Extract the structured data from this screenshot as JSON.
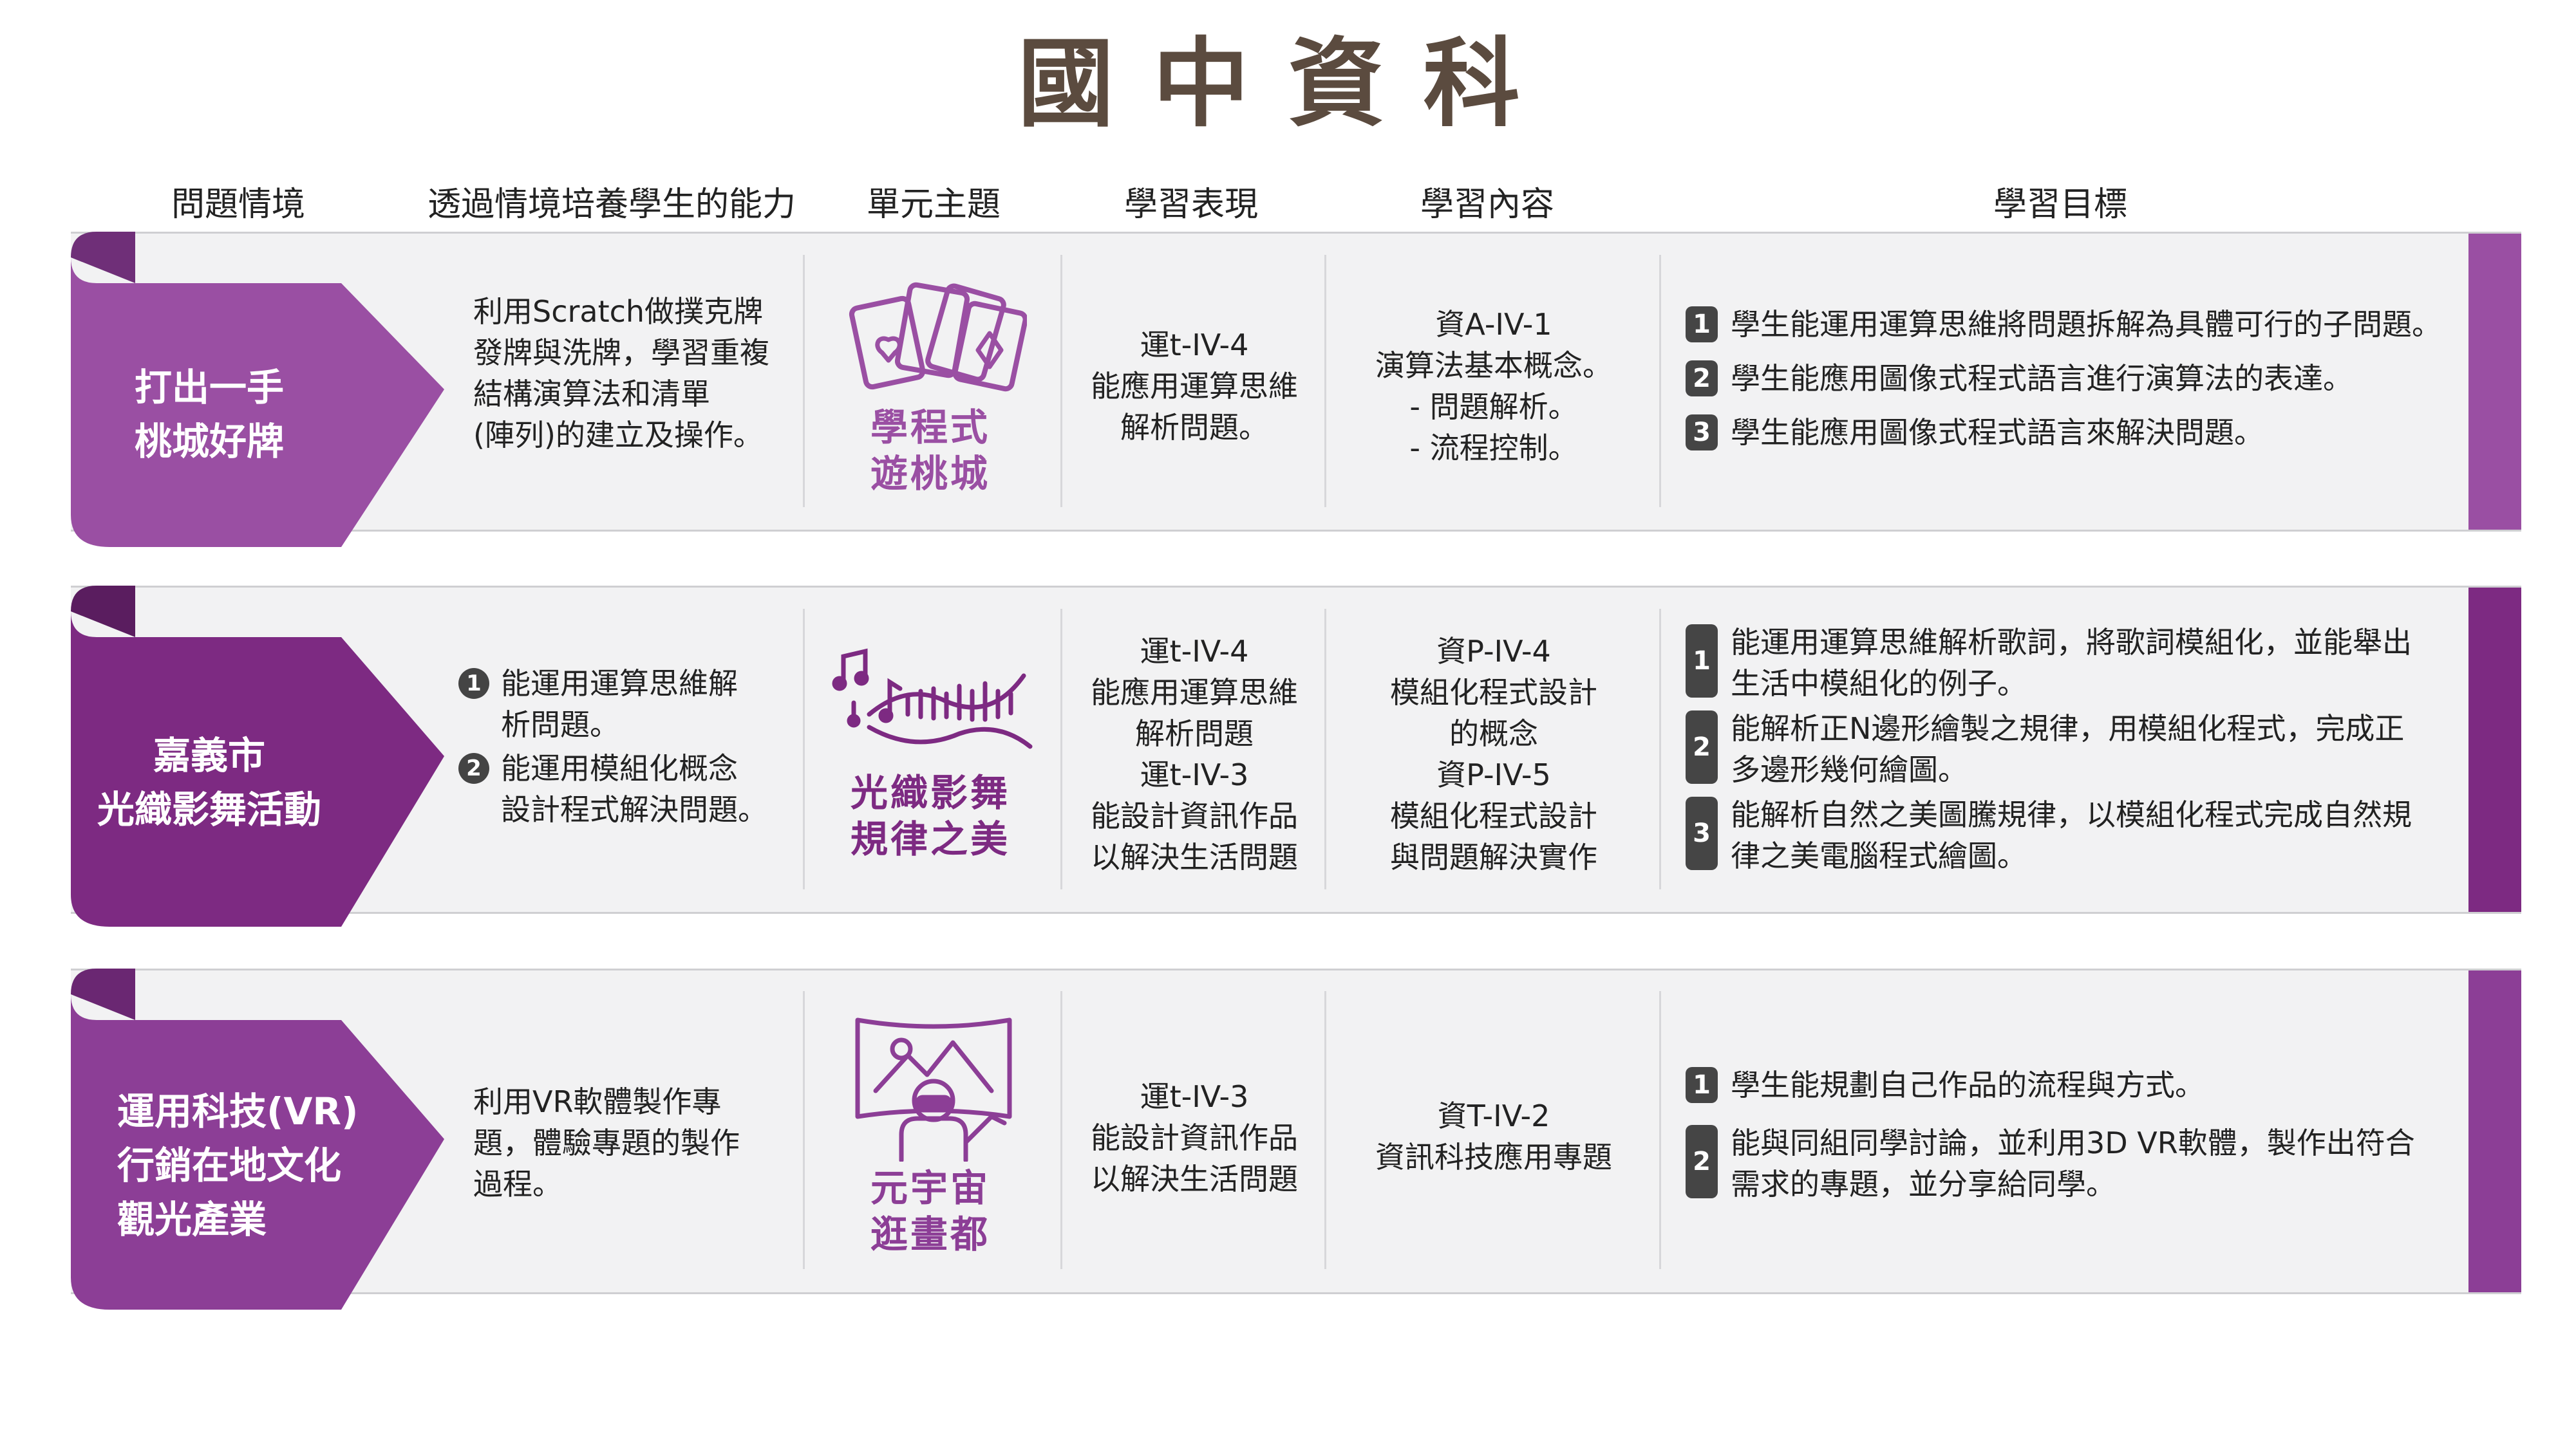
{
  "page_title": "國中資科",
  "columns": [
    "問題情境",
    "透過情境培養學生的能力",
    "單元主題",
    "學習表現",
    "學習內容",
    "學習目標"
  ],
  "colors": {
    "title": "#5b4b3f",
    "row1_accent": "#9a4fa3",
    "row2_accent": "#7d2a82",
    "row3_accent": "#8c3e96",
    "band_bg": "#f2f2f3"
  },
  "rows": [
    {
      "scenario": [
        "打出一手",
        "桃城好牌"
      ],
      "ability_text": [
        "利用Scratch做撲克牌",
        "發牌與洗牌，學習重複",
        "結構演算法和清單",
        "(陣列)的建立及操作。"
      ],
      "theme_icon": "playing-cards-icon",
      "theme": [
        "學程式",
        "遊桃城"
      ],
      "performance": [
        "運t-IV-4",
        "能應用運算思維",
        "解析問題。"
      ],
      "content": [
        "資A-IV-1",
        "演算法基本概念。",
        "- 問題解析。",
        "- 流程控制。"
      ],
      "goals": [
        {
          "num": "1",
          "lines": [
            "學生能運用運算思維將問題拆解為具體可行的子問題。"
          ]
        },
        {
          "num": "2",
          "lines": [
            "學生能應用圖像式程式語言進行演算法的表達。"
          ]
        },
        {
          "num": "3",
          "lines": [
            "學生能應用圖像式程式語言來解決問題。"
          ]
        }
      ]
    },
    {
      "scenario": [
        "嘉義市",
        "光織影舞活動"
      ],
      "ability_items": [
        {
          "num": "1",
          "lines": [
            "能運用運算思維解",
            "析問題。"
          ]
        },
        {
          "num": "2",
          "lines": [
            "能運用模組化概念",
            "設計程式解決問題。"
          ]
        }
      ],
      "theme_icon": "music-notes-icon",
      "theme": [
        "光織影舞",
        "規律之美"
      ],
      "performance": [
        "運t-IV-4",
        "能應用運算思維",
        "解析問題",
        "運t-IV-3",
        "能設計資訊作品",
        "以解決生活問題"
      ],
      "content": [
        "資P-IV-4",
        "模組化程式設計",
        "的概念",
        "資P-IV-5",
        "模組化程式設計",
        "與問題解決實作"
      ],
      "goals": [
        {
          "num": "1",
          "lines": [
            "能運用運算思維解析歌詞，將歌詞模組化，並能舉出",
            "生活中模組化的例子。"
          ]
        },
        {
          "num": "2",
          "lines": [
            "能解析正N邊形繪製之規律，用模組化程式，完成正",
            "多邊形幾何繪圖。"
          ]
        },
        {
          "num": "3",
          "lines": [
            "能解析自然之美圖騰規律，以模組化程式完成自然規",
            "律之美電腦程式繪圖。"
          ]
        }
      ]
    },
    {
      "scenario": [
        "運用科技(VR)",
        "行銷在地文化",
        "觀光產業"
      ],
      "ability_text": [
        "利用VR軟體製作專",
        "題，體驗專題的製作",
        "過程。"
      ],
      "theme_icon": "vr-headset-icon",
      "theme": [
        "元宇宙",
        "逛畫都"
      ],
      "performance": [
        "運t-IV-3",
        "能設計資訊作品",
        "以解決生活問題"
      ],
      "content": [
        "資T-IV-2",
        "資訊科技應用專題"
      ],
      "goals": [
        {
          "num": "1",
          "lines": [
            "學生能規劃自己作品的流程與方式。"
          ]
        },
        {
          "num": "2",
          "lines": [
            "能與同組同學討論，並利用3D VR軟體，製作出符合",
            "需求的專題，並分享給同學。"
          ]
        }
      ]
    }
  ]
}
